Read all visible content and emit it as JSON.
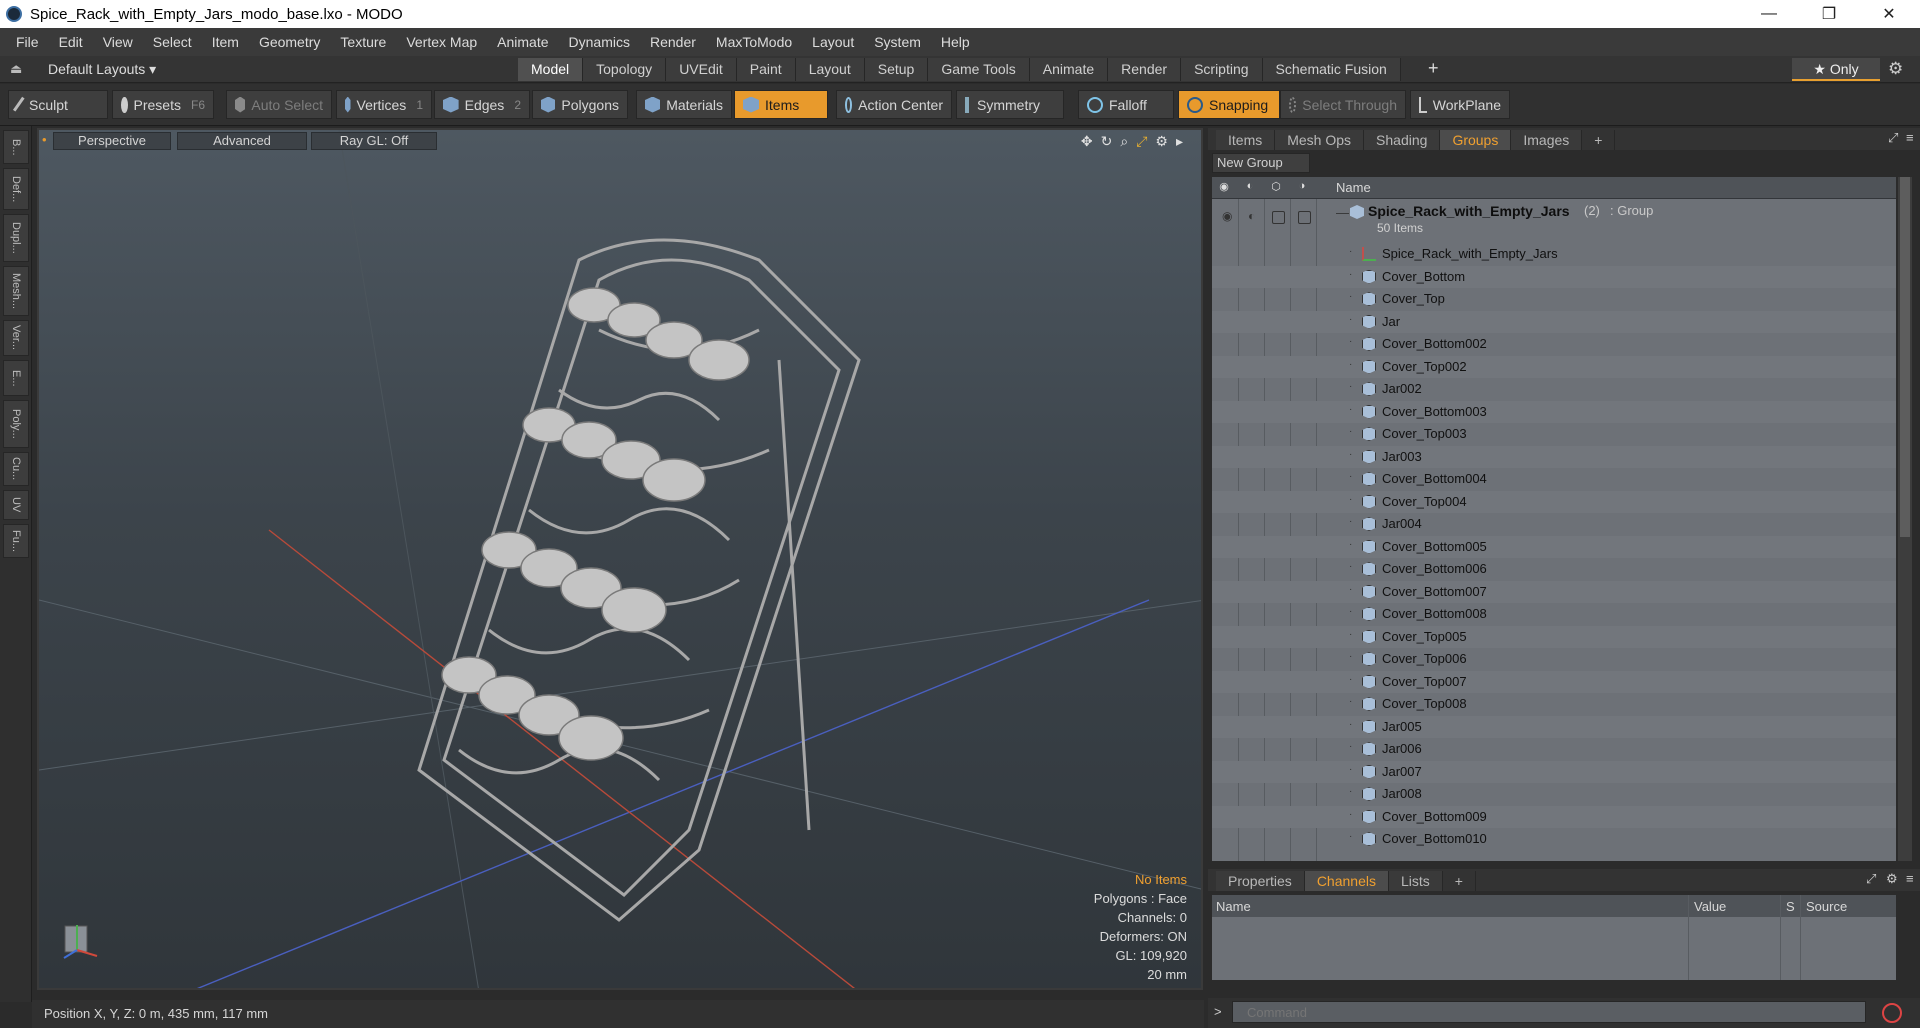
{
  "window": {
    "title": "Spice_Rack_with_Empty_Jars_modo_base.lxo - MODO",
    "controls": [
      "—",
      "❐",
      "✕"
    ]
  },
  "menu": [
    "File",
    "Edit",
    "View",
    "Select",
    "Item",
    "Geometry",
    "Texture",
    "Vertex Map",
    "Animate",
    "Dynamics",
    "Render",
    "MaxToModo",
    "Layout",
    "System",
    "Help"
  ],
  "layouts": {
    "preset": "Default Layouts ▾",
    "tabs": [
      "Model",
      "Topology",
      "UVEdit",
      "Paint",
      "Layout",
      "Setup",
      "Game Tools",
      "Animate",
      "Render",
      "Scripting",
      "Schematic Fusion"
    ],
    "active_tab": "Model",
    "add": "+",
    "only_label": "★ Only"
  },
  "toolbar": {
    "sculpt": "Sculpt",
    "presets": "Presets",
    "presets_key": "F6",
    "auto_select": "Auto Select",
    "vertices": "Vertices",
    "vertices_count": "1",
    "edges": "Edges",
    "edges_count": "2",
    "polygons": "Polygons",
    "materials": "Materials",
    "items": "Items",
    "action_center": "Action Center",
    "symmetry": "Symmetry",
    "falloff": "Falloff",
    "snapping": "Snapping",
    "select_through": "Select Through",
    "workplane": "WorkPlane"
  },
  "left_strip": [
    "B...",
    "Def...",
    "Dupl...",
    "Mesh...",
    "Ver...",
    "E...",
    "Poly...",
    "Cu...",
    "UV",
    "Fu..."
  ],
  "viewport": {
    "view": "Perspective",
    "mode": "Advanced",
    "raygl": "Ray GL: Off",
    "info": {
      "selection": "No Items",
      "polygons": "Polygons : Face",
      "channels": "Channels: 0",
      "deformers": "Deformers: ON",
      "gl": "GL: 109,920",
      "scale": "20 mm"
    }
  },
  "status": "Position X, Y, Z:  0 m, 435 mm, 117 mm",
  "right_panel": {
    "tabs": [
      "Items",
      "Mesh Ops",
      "Shading",
      "Groups",
      "Images"
    ],
    "active_tab": "Groups",
    "add": "+",
    "new_group": "New Group",
    "column_name": "Name",
    "group": {
      "name": "Spice_Rack_with_Empty_Jars",
      "count": "(2)",
      "type": ": Group",
      "items_label": "50 Items"
    },
    "items": [
      "Spice_Rack_with_Empty_Jars",
      "Cover_Bottom",
      "Cover_Top",
      "Jar",
      "Cover_Bottom002",
      "Cover_Top002",
      "Jar002",
      "Cover_Bottom003",
      "Cover_Top003",
      "Jar003",
      "Cover_Bottom004",
      "Cover_Top004",
      "Jar004",
      "Cover_Bottom005",
      "Cover_Bottom006",
      "Cover_Bottom007",
      "Cover_Bottom008",
      "Cover_Top005",
      "Cover_Top006",
      "Cover_Top007",
      "Cover_Top008",
      "Jar005",
      "Jar006",
      "Jar007",
      "Jar008",
      "Cover_Bottom009",
      "Cover_Bottom010"
    ]
  },
  "bottom_panel": {
    "tabs": [
      "Properties",
      "Channels",
      "Lists"
    ],
    "active_tab": "Channels",
    "add": "+",
    "columns": [
      "Name",
      "Value",
      "S",
      "Source"
    ]
  },
  "command": {
    "placeholder": "Command",
    "prompt": ">"
  },
  "colors": {
    "accent": "#e89a2c",
    "viewport_top": "#4e5861",
    "viewport_bottom": "#30363b",
    "list_bg": "#6d7177"
  }
}
